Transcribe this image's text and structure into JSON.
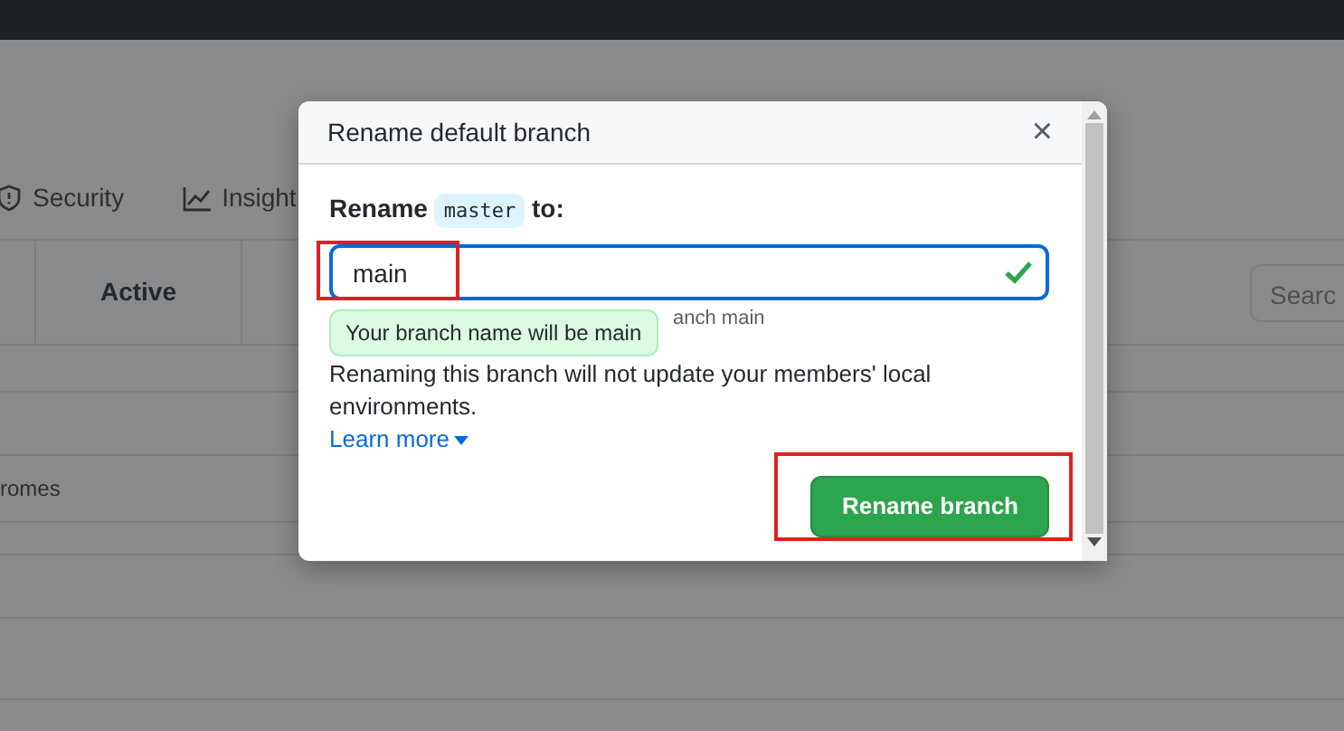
{
  "page": {
    "tabs": [
      {
        "label": "Security",
        "kind": "shield"
      },
      {
        "label": "Insight",
        "kind": "graph"
      }
    ],
    "table": {
      "columns": [
        "Active"
      ],
      "search": {
        "placeholder": "Searc"
      },
      "rows": [
        "romes"
      ]
    }
  },
  "dialog": {
    "title": "Rename default branch",
    "close": "×",
    "prompt_start": "Rename",
    "prompt_code": "master",
    "prompt_end": "to:",
    "input": {
      "value": "main",
      "valid": true
    },
    "hint_end": "anch main",
    "tooltip": "Your branch name will be main",
    "warning": "Renaming this branch will not update your members' local environments.",
    "link": "Learn more",
    "button": "Rename branch"
  }
}
